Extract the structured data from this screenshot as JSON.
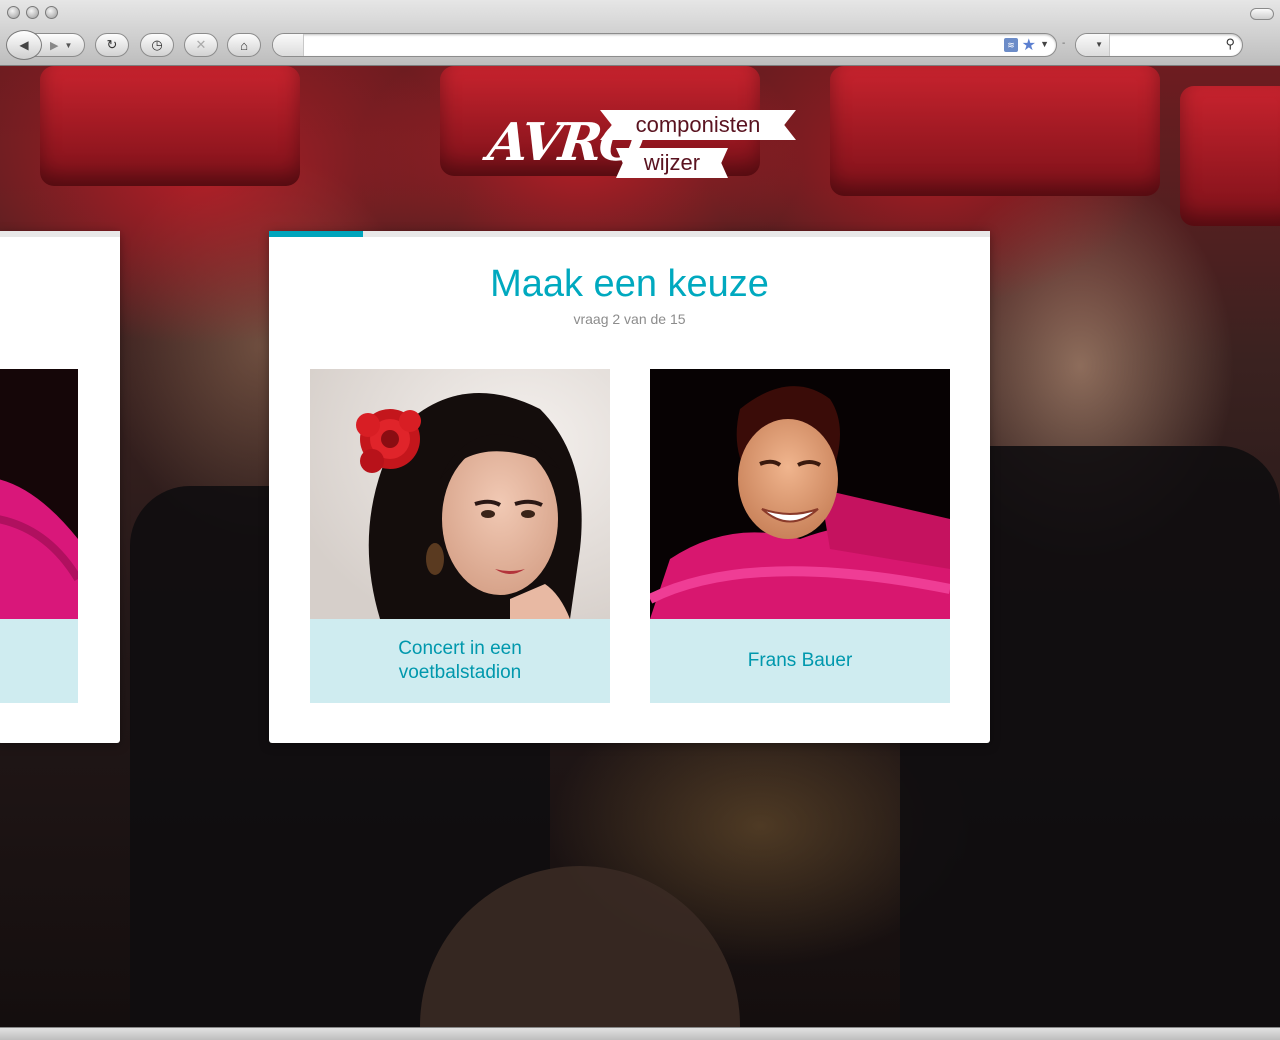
{
  "browser": {
    "address_value": "",
    "search_value": ""
  },
  "logo": {
    "brand": "AVRO",
    "ribbon_top": "componisten",
    "ribbon_bottom": "wijzer"
  },
  "quiz": {
    "title": "Maak een keuze",
    "progress_text": "vraag 2 van de 15",
    "progress_fraction": 0.13,
    "options": [
      {
        "label": "Concert in een voetbalstadion",
        "image": "woman-red-flower-photo"
      },
      {
        "label": "Frans Bauer",
        "image": "man-pink-shirt-photo"
      }
    ]
  },
  "colors": {
    "accent": "#00a9bf",
    "option_label_bg": "#cfecf0",
    "option_label_text": "#0098ad",
    "logo_ribbon_text": "#5a1320"
  }
}
